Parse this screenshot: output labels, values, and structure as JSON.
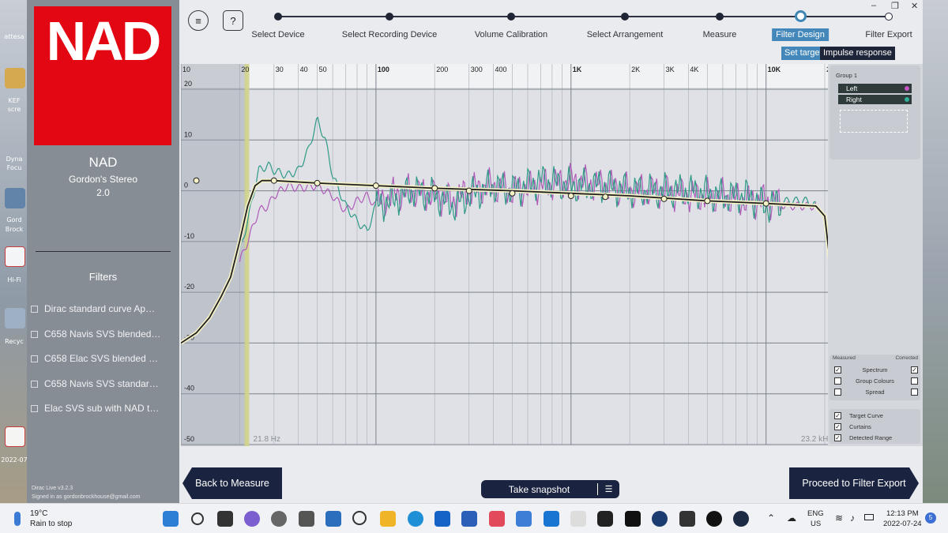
{
  "desktop": {
    "left_labels": [
      "attesa",
      "KEF",
      "scre",
      "Dyna",
      "Focu",
      "Gord",
      "Brock",
      "Hi-Fi",
      "Recyc",
      "2022-07"
    ],
    "right_labels": []
  },
  "sidebar": {
    "logo": "NAD",
    "device_name": "NAD",
    "profile_name": "Gordon's Stereo",
    "profile_version": "2.0",
    "filters_title": "Filters",
    "filters": [
      "Dirac standard curve Ap…",
      "C658 Navis SVS blended…",
      "C658 Elac SVS blended …",
      "C658 Navis SVS standar…",
      "Elac SVS sub with NAD t…"
    ],
    "version": "Dirac Live v3.2.3",
    "signed_in": "Signed in as gordonbrockhouse@gmail.com"
  },
  "toolbar": {
    "menu_icon": "≡",
    "help_icon": "?"
  },
  "steps": [
    {
      "label": "Select Device",
      "active": false
    },
    {
      "label": "Select Recording Device",
      "active": false
    },
    {
      "label": "Volume Calibration",
      "active": false
    },
    {
      "label": "Select Arrangement",
      "active": false
    },
    {
      "label": "Measure",
      "active": false
    },
    {
      "label": "Filter Design",
      "active": true
    },
    {
      "label": "Filter Export",
      "active": false
    }
  ],
  "subtabs": {
    "set_target": "Set target",
    "impulse_response": "Impulse response"
  },
  "window_controls": {
    "minimize": "–",
    "restore": "❐",
    "close": "✕"
  },
  "chart_data": {
    "type": "line",
    "x_scale": "log",
    "xlim": [
      10,
      20000
    ],
    "ylim": [
      -50,
      20
    ],
    "x_ticks": [
      {
        "v": 10,
        "l": "10"
      },
      {
        "v": 20,
        "l": "20"
      },
      {
        "v": 30,
        "l": "30"
      },
      {
        "v": 40,
        "l": "40"
      },
      {
        "v": 50,
        "l": "50"
      },
      {
        "v": 100,
        "l": "100"
      },
      {
        "v": 200,
        "l": "200"
      },
      {
        "v": 300,
        "l": "300"
      },
      {
        "v": 400,
        "l": "400"
      },
      {
        "v": 1000,
        "l": "1K"
      },
      {
        "v": 2000,
        "l": "2K"
      },
      {
        "v": 3000,
        "l": "3K"
      },
      {
        "v": 4000,
        "l": "4K"
      },
      {
        "v": 10000,
        "l": "10K"
      },
      {
        "v": 20000,
        "l": "20K"
      }
    ],
    "y_ticks": [
      20,
      10,
      0,
      -10,
      -20,
      -30,
      -40,
      -50
    ],
    "curtain_left_hz": 21.8,
    "curtain_right_hz": 23200,
    "curtain_left_label": "21.8 Hz",
    "curtain_right_label": "23.2 kHz",
    "grid": true,
    "series": [
      {
        "name": "Left",
        "color": "#b05bb8",
        "points": [
          [
            20,
            -14
          ],
          [
            22,
            -10
          ],
          [
            25,
            -4
          ],
          [
            28,
            -3
          ],
          [
            30,
            -1
          ],
          [
            35,
            1
          ],
          [
            40,
            0.5
          ],
          [
            50,
            1
          ],
          [
            60,
            -1
          ],
          [
            70,
            -4
          ],
          [
            80,
            -2
          ],
          [
            90,
            -1
          ],
          [
            100,
            -3
          ],
          [
            120,
            -1
          ],
          [
            150,
            0
          ],
          [
            200,
            -1
          ],
          [
            250,
            -2
          ],
          [
            300,
            0
          ],
          [
            400,
            1
          ],
          [
            500,
            0
          ],
          [
            700,
            1
          ],
          [
            1000,
            2
          ],
          [
            1500,
            1
          ],
          [
            2000,
            0
          ],
          [
            3000,
            0
          ],
          [
            4000,
            -1
          ],
          [
            6000,
            -1
          ],
          [
            8000,
            -2
          ],
          [
            10000,
            -2
          ],
          [
            13000,
            -3
          ],
          [
            16000,
            -3
          ],
          [
            18000,
            -3
          ]
        ]
      },
      {
        "name": "Right",
        "color": "#2f9a86",
        "points": [
          [
            20,
            -12
          ],
          [
            22,
            -6
          ],
          [
            25,
            4
          ],
          [
            28,
            5
          ],
          [
            30,
            4
          ],
          [
            35,
            3
          ],
          [
            40,
            4
          ],
          [
            45,
            8
          ],
          [
            50,
            14
          ],
          [
            55,
            10
          ],
          [
            60,
            3
          ],
          [
            70,
            -3
          ],
          [
            80,
            -6
          ],
          [
            90,
            -8
          ],
          [
            100,
            -3
          ],
          [
            120,
            -2
          ],
          [
            150,
            0
          ],
          [
            200,
            -1
          ],
          [
            250,
            -3
          ],
          [
            300,
            -1
          ],
          [
            400,
            1
          ],
          [
            500,
            0
          ],
          [
            700,
            2
          ],
          [
            1000,
            1
          ],
          [
            1500,
            1
          ],
          [
            2000,
            0
          ],
          [
            3000,
            0
          ],
          [
            4000,
            0
          ],
          [
            6000,
            -1
          ],
          [
            8000,
            -1
          ],
          [
            10000,
            -3
          ],
          [
            13000,
            -2
          ],
          [
            16000,
            -2
          ],
          [
            18000,
            -3
          ]
        ]
      },
      {
        "name": "Target Curve",
        "color": "#1f1f1f",
        "points": [
          [
            10,
            -30
          ],
          [
            12,
            -28
          ],
          [
            14,
            -25
          ],
          [
            16,
            -21
          ],
          [
            18,
            -17
          ],
          [
            20,
            -10
          ],
          [
            22,
            -3
          ],
          [
            24,
            1
          ],
          [
            26,
            2
          ],
          [
            30,
            2
          ],
          [
            50,
            1.5
          ],
          [
            100,
            1
          ],
          [
            200,
            0.5
          ],
          [
            500,
            0
          ],
          [
            1000,
            -0.5
          ],
          [
            2000,
            -1
          ],
          [
            5000,
            -2
          ],
          [
            10000,
            -2.5
          ],
          [
            18000,
            -3
          ],
          [
            20000,
            -5
          ],
          [
            21000,
            -12
          ],
          [
            22000,
            -19
          ]
        ]
      }
    ],
    "target_handles": [
      [
        12,
        2
      ],
      [
        30,
        2
      ],
      [
        50,
        1.5
      ],
      [
        100,
        1
      ],
      [
        200,
        0.5
      ],
      [
        300,
        0
      ],
      [
        500,
        -0.5
      ],
      [
        1000,
        -1
      ],
      [
        1500,
        -1.2
      ],
      [
        3000,
        -1.6
      ],
      [
        5000,
        -2
      ],
      [
        10000,
        -2.5
      ],
      [
        23000,
        -2.5
      ]
    ]
  },
  "right_panel": {
    "group_label": "Group 1",
    "channels": [
      {
        "name": "Left",
        "color": "#c455c4"
      },
      {
        "name": "Right",
        "color": "#2fae98"
      }
    ],
    "measured_label": "Measured",
    "corrected_label": "Corrected",
    "spectrum_label": "Spectrum",
    "group_colours_label": "Group Colours",
    "spread_label": "Spread",
    "target_curve_label": "Target Curve",
    "curtains_label": "Curtains",
    "detected_range_label": "Detected Range"
  },
  "bottom": {
    "back_label": "Back to Measure",
    "snapshot_label": "Take snapshot",
    "snapshot_menu_icon": "☰",
    "proceed_label": "Proceed to Filter Export"
  },
  "taskbar": {
    "weather_temp": "19°C",
    "weather_desc": "Rain to stop",
    "lang_top": "ENG",
    "lang_bottom": "US",
    "time": "12:13 PM",
    "date": "2022-07-24",
    "notification_count": "5"
  }
}
